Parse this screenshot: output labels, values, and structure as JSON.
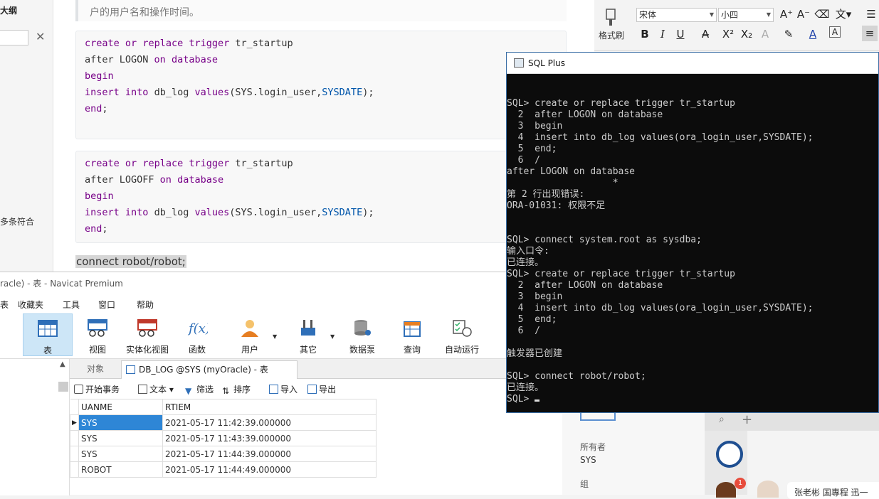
{
  "editor": {
    "outline_title": "大纲",
    "outline_item": "多条符合",
    "quote_text": "户的用户名和操作时间。",
    "code_blocks": [
      {
        "lines": [
          [
            [
              "kw",
              "create"
            ],
            [
              "t",
              " "
            ],
            [
              "kw",
              "or"
            ],
            [
              "t",
              " "
            ],
            [
              "kw",
              "replace"
            ],
            [
              "t",
              " "
            ],
            [
              "kw",
              "trigger"
            ],
            [
              "t",
              " tr_startup"
            ]
          ],
          [
            [
              "t",
              "after LOGON "
            ],
            [
              "kw",
              "on"
            ],
            [
              "t",
              " "
            ],
            [
              "kw",
              "database"
            ]
          ],
          [
            [
              "kw",
              "begin"
            ]
          ],
          [
            [
              "kw",
              "insert"
            ],
            [
              "t",
              " "
            ],
            [
              "kw",
              "into"
            ],
            [
              "t",
              " db_log "
            ],
            [
              "kw",
              "values"
            ],
            [
              "t",
              "(SYS.login_user,"
            ],
            [
              "fn",
              "SYSDATE"
            ],
            [
              "t",
              ");"
            ]
          ],
          [
            [
              "kw",
              "end"
            ],
            [
              "t",
              ";"
            ]
          ]
        ]
      },
      {
        "lines": [
          [
            [
              "kw",
              "create"
            ],
            [
              "t",
              " "
            ],
            [
              "kw",
              "or"
            ],
            [
              "t",
              " "
            ],
            [
              "kw",
              "replace"
            ],
            [
              "t",
              " "
            ],
            [
              "kw",
              "trigger"
            ],
            [
              "t",
              " tr_startup"
            ]
          ],
          [
            [
              "t",
              "after LOGOFF "
            ],
            [
              "kw",
              "on"
            ],
            [
              "t",
              " "
            ],
            [
              "kw",
              "database"
            ]
          ],
          [
            [
              "kw",
              "begin"
            ]
          ],
          [
            [
              "kw",
              "insert"
            ],
            [
              "t",
              " "
            ],
            [
              "kw",
              "into"
            ],
            [
              "t",
              " db_log "
            ],
            [
              "kw",
              "values"
            ],
            [
              "t",
              "(SYS.login_user,"
            ],
            [
              "fn",
              "SYSDATE"
            ],
            [
              "t",
              ");"
            ]
          ],
          [
            [
              "kw",
              "end"
            ],
            [
              "t",
              ";"
            ]
          ]
        ]
      }
    ],
    "connect_line": "connect robot/robot;"
  },
  "ribbon": {
    "format_painter": "格式刷",
    "font_name": "宋体",
    "font_size": "小四"
  },
  "navicat": {
    "title": "racle) - 表 - Navicat Premium",
    "menu": [
      "表",
      "收藏夹",
      "工具",
      "窗口",
      "帮助"
    ],
    "toolbar": [
      {
        "label": "表",
        "icon": "table-icon"
      },
      {
        "label": "视图",
        "icon": "view-icon"
      },
      {
        "label": "实体化视图",
        "icon": "materialized-view-icon"
      },
      {
        "label": "函数",
        "icon": "function-icon"
      },
      {
        "label": "用户",
        "icon": "user-icon"
      },
      {
        "label": "其它",
        "icon": "tools-icon"
      },
      {
        "label": "数据泵",
        "icon": "data-pump-icon"
      },
      {
        "label": "查询",
        "icon": "query-icon"
      },
      {
        "label": "自动运行",
        "icon": "schedule-icon"
      }
    ],
    "tab_objects": "对象",
    "tab_active": "DB_LOG @SYS (myOracle) - 表",
    "actions": [
      "开始事务",
      "文本",
      "筛选",
      "排序",
      "导入",
      "导出"
    ],
    "columns": [
      "UANME",
      "RTIEM"
    ],
    "rows": [
      [
        "SYS",
        "2021-05-17 11:42:39.000000"
      ],
      [
        "SYS",
        "2021-05-17 11:43:39.000000"
      ],
      [
        "SYS",
        "2021-05-17 11:44:39.000000"
      ],
      [
        "ROBOT",
        "2021-05-17 11:44:49.000000"
      ]
    ]
  },
  "props": {
    "owner_label": "所有者",
    "owner_value": "SYS",
    "group_label": "组",
    "badge": "1",
    "chat_snippet": "张老彬 国專程 迅一"
  },
  "sqlplus": {
    "title": "SQL Plus",
    "lines": [
      "SQL> create or replace trigger tr_startup",
      "  2  after LOGON on database",
      "  3  begin",
      "  4  insert into db_log values(ora_login_user,SYSDATE);",
      "  5  end;",
      "  6  /",
      "after LOGON on database",
      "                   *",
      "第 2 行出现错误:",
      "ORA-01031: 权限不足",
      "",
      "",
      "SQL> connect system.root as sysdba;",
      "输入口令:",
      "已连接。",
      "SQL> create or replace trigger tr_startup",
      "  2  after LOGON on database",
      "  3  begin",
      "  4  insert into db_log values(ora_login_user,SYSDATE);",
      "  5  end;",
      "  6  /",
      "",
      "触发器已创建",
      "",
      "SQL> connect robot/robot;",
      "已连接。",
      "SQL> "
    ]
  }
}
